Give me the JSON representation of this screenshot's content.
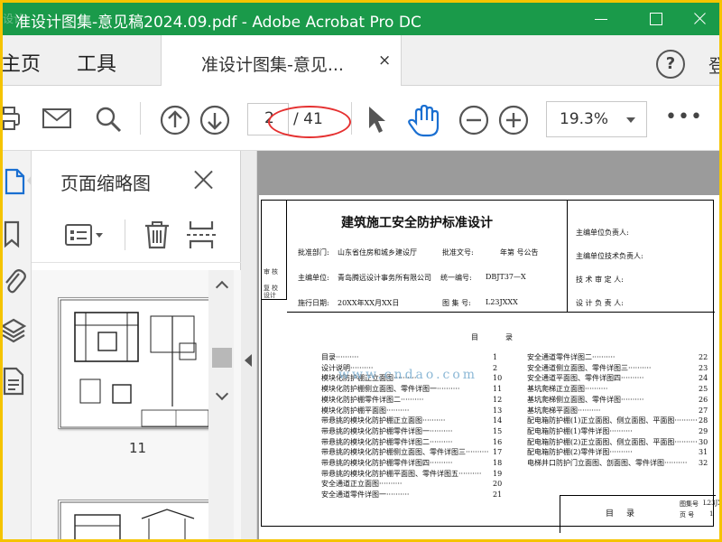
{
  "window": {
    "title": "准设计图集-意见稿2024.09.pdf - Adobe Acrobat Pro DC",
    "app_icon_text": "设计"
  },
  "tabs": {
    "home": "主页",
    "tools": "工具",
    "document_tab_label": "准设计图集-意见...",
    "document_tab_close": "×",
    "help_icon": "?",
    "signin_partial": "登"
  },
  "toolbar": {
    "icons": [
      "print-icon",
      "mail-icon",
      "search-icon",
      "page-up-icon",
      "page-down-icon",
      "cursor-icon",
      "hand-icon",
      "zoom-out-icon",
      "zoom-in-icon",
      "more-icon"
    ],
    "page_current": "2",
    "page_total": "/ 41",
    "zoom_value": "19.3%",
    "more_label": "•••",
    "annotation_color": "#e53030"
  },
  "sidebar": {
    "title": "页面缩略图",
    "rail_icons": [
      "page-thumbnails-icon",
      "bookmark-icon",
      "attachment-icon",
      "layers-icon",
      "document-icon"
    ],
    "panel_tools": [
      "thumbnail-options-icon",
      "delete-page-icon",
      "extract-page-icon"
    ],
    "thumbnails": [
      {
        "page_label": "11"
      },
      {
        "page_label": ""
      }
    ]
  },
  "document": {
    "side_labels": [
      "审",
      "核",
      "复",
      "校",
      "设计"
    ],
    "header": {
      "main_title": "建筑施工安全防护标准设计",
      "approve_dept_label": "批准部门:",
      "approve_dept_value": "山东省住房和城乡建设厅",
      "approve_doc_label": "批准文号:",
      "approve_doc_value": "年第 号公告",
      "editor_unit_label": "主编单位:",
      "editor_unit_value": "青岛腾远设计事务所有限公司",
      "unified_no_label": "统一编号:",
      "unified_no_value": "DBJT37—X",
      "effective_date_label": "施行日期:",
      "effective_date_value": "20XX年XX月XX日",
      "atlas_no_label": "图 集 号:",
      "atlas_no_value": "L23JXXX",
      "right_fields": [
        "主编单位负责人:",
        "主编单位技术负责人:",
        "技 术 审 定 人:",
        "设 计 负 责 人:"
      ]
    },
    "toc_title": "目录",
    "toc_left": [
      {
        "title": "目录",
        "page": "1"
      },
      {
        "title": "设计说明",
        "page": "2"
      },
      {
        "title": "模块化防护棚正立面图",
        "page": "10"
      },
      {
        "title": "模块化防护棚侧立面图、零件详图一",
        "page": "11"
      },
      {
        "title": "模块化防护棚零件详图二",
        "page": "12"
      },
      {
        "title": "模块化防护棚平面图",
        "page": "13"
      },
      {
        "title": "带悬挑的模块化防护棚正立面图",
        "page": "14"
      },
      {
        "title": "带悬挑的模块化防护棚零件详图一",
        "page": "15"
      },
      {
        "title": "带悬挑的模块化防护棚零件详图二",
        "page": "16"
      },
      {
        "title": "带悬挑的模块化防护棚侧立面图、零件详图三",
        "page": "17"
      },
      {
        "title": "带悬挑的模块化防护棚零件详图四",
        "page": "18"
      },
      {
        "title": "带悬挑的模块化防护棚平面图、零件详图五",
        "page": "19"
      },
      {
        "title": "安全通道正立面图",
        "page": "20"
      },
      {
        "title": "安全通道零件详图一",
        "page": "21"
      }
    ],
    "toc_right": [
      {
        "title": "安全通道零件详图二",
        "page": "22"
      },
      {
        "title": "安全通道侧立面图、零件详图三",
        "page": "23"
      },
      {
        "title": "安全通道平面图、零件详图四",
        "page": "24"
      },
      {
        "title": "基坑爬梯正立面图",
        "page": "25"
      },
      {
        "title": "基坑爬梯侧立面图、零件详图",
        "page": "26"
      },
      {
        "title": "基坑爬梯平面图",
        "page": "27"
      },
      {
        "title": "配电箱防护棚(1)正立面图、侧立面图、平面图",
        "page": "28"
      },
      {
        "title": "配电箱防护棚(1)零件详图",
        "page": "29"
      },
      {
        "title": "配电箱防护棚(2)正立面图、侧立面图、平面图",
        "page": "30"
      },
      {
        "title": "配电箱防护棚(2)零件详图",
        "page": "31"
      },
      {
        "title": "电梯井口防护门立面图、剖面图、零件详图",
        "page": "32"
      }
    ],
    "footer": {
      "title": "目录",
      "atlas_no_label": "图集号",
      "atlas_no_value": "L23JX",
      "page_label": "页 号",
      "page_value": "1"
    },
    "watermark": "www.cndao.com"
  }
}
